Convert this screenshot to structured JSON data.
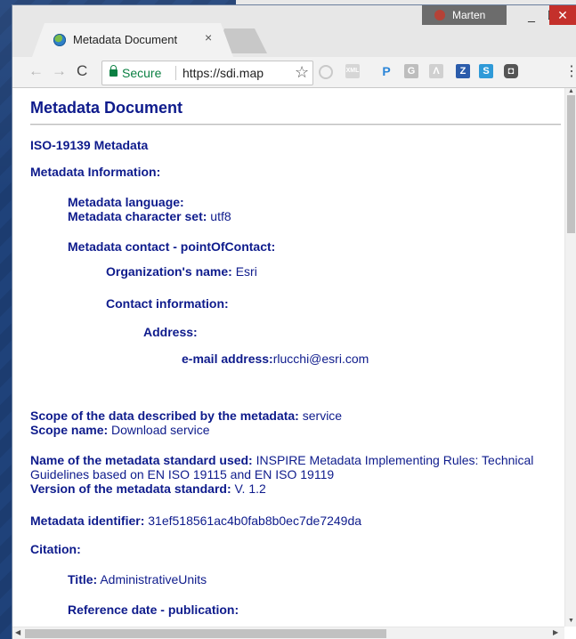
{
  "browser": {
    "tab_title": "Metadata Document",
    "tab_close": "×",
    "profile_name": "Marten",
    "window_buttons": {
      "minimize": "_",
      "maximize": "☐",
      "close": "✕"
    },
    "nav": {
      "back": "←",
      "forward": "→",
      "reload": "C"
    },
    "secure_label": "Secure",
    "url": "https://sdi.map",
    "star": "☆",
    "extensions": [
      "",
      "XML",
      "P",
      "G",
      "Λ",
      "Z",
      "S",
      "◘"
    ],
    "menu": "⋮"
  },
  "document": {
    "title": "Metadata Document",
    "standard": "ISO-19139 Metadata",
    "metadata_information": "Metadata Information:",
    "metadata_language_label": "Metadata language:",
    "metadata_charset_label": "Metadata character set:",
    "metadata_charset_value": "utf8",
    "metadata_contact": "Metadata contact - pointOfContact:",
    "org_name_label": "Organization's name:",
    "org_name_value": "Esri",
    "contact_info": "Contact information:",
    "address": "Address:",
    "email_label": "e-mail address:",
    "email_value": "rlucchi@esri.com",
    "scope_label": "Scope of the data described by the metadata:",
    "scope_value": "service",
    "scope_name_label": "Scope name:",
    "scope_name_value": "Download service",
    "std_name_label": "Name of the metadata standard used:",
    "std_name_value": "INSPIRE Metadata Implementing Rules: Technical Guidelines based on EN ISO 19115 and EN ISO 19119",
    "std_version_label": "Version of the metadata standard:",
    "std_version_value": "V. 1.2",
    "identifier_label": "Metadata identifier:",
    "identifier_value": "31ef518561ac4b0fab8b0ec7de7249da",
    "citation": "Citation:",
    "title_label": "Title:",
    "title_value": "AdministrativeUnits",
    "ref_date": "Reference date - publication:"
  },
  "scrollbar": {
    "up": "▲",
    "down": "▼",
    "left": "◀",
    "right": "▶"
  }
}
